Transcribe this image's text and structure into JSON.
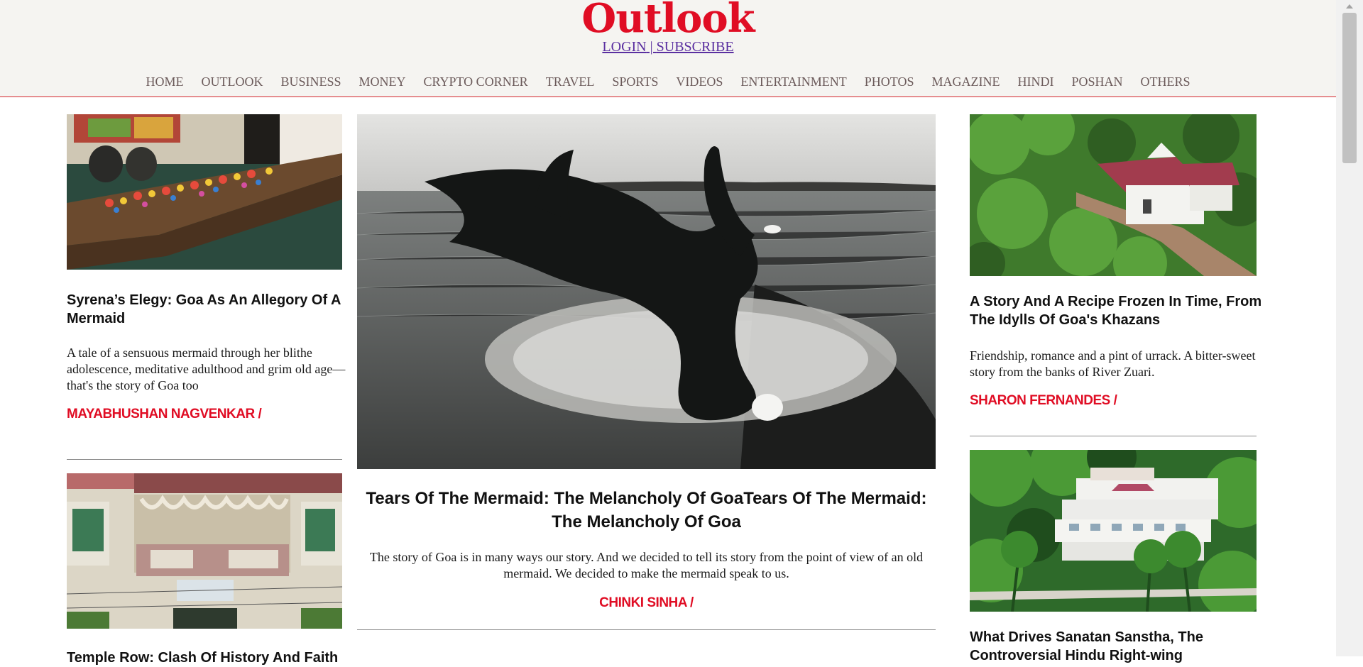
{
  "brand": {
    "logo": "Outlook",
    "accent": "#e00d24"
  },
  "auth": {
    "login": "LOGIN",
    "separator": " | ",
    "subscribe": "SUBSCRIBE"
  },
  "nav": [
    "HOME",
    "OUTLOOK",
    "BUSINESS",
    "MONEY",
    "CRYPTO CORNER",
    "TRAVEL",
    "SPORTS",
    "VIDEOS",
    "ENTERTAINMENT",
    "PHOTOS",
    "MAGAZINE",
    "HINDI",
    "POSHAN",
    "OTHERS"
  ],
  "left_column": {
    "article1": {
      "image_alt": "Wooden boat filled with colourful clay figurines",
      "headline": "Syrena’s Elegy: Goa As An Allegory Of A Mermaid",
      "summary": "A tale of a sensuous mermaid through her blithe adolescence, meditative adulthood and grim old age—that's the story of Goa too",
      "author": "MAYABHUSHAN NAGVENKAR /"
    },
    "article2": {
      "image_alt": "Old Goan building with a wooden balcony and Kannada signboard",
      "headline": "Temple Row: Clash Of History And Faith"
    }
  },
  "feature": {
    "image_alt": "Black-and-white photo of a mermaid silhouette cut-out by the sea",
    "headline": "Tears Of The Mermaid: The Melancholy Of GoaTears Of The Mermaid: The Melancholy Of Goa",
    "summary": "The story of Goa is in many ways our story. And we decided to tell its story from the point of view of an old mermaid. We decided to make the mermaid speak to us.",
    "author": "CHINKI SINHA /"
  },
  "right_column": {
    "article1": {
      "image_alt": "Aerial view of a white chapel among green trees",
      "headline": "A Story And A Recipe Frozen In Time, From The Idylls Of Goa's Khazans",
      "summary": "Friendship, romance and a pint of urrack. A bitter-sweet story from the banks of River Zuari.",
      "author": "SHARON FERNANDES /"
    },
    "article2": {
      "image_alt": "Hillside complex of white buildings among coconut palms",
      "headline": "What Drives Sanatan Sanstha, The Controversial Hindu Right-wing"
    }
  }
}
